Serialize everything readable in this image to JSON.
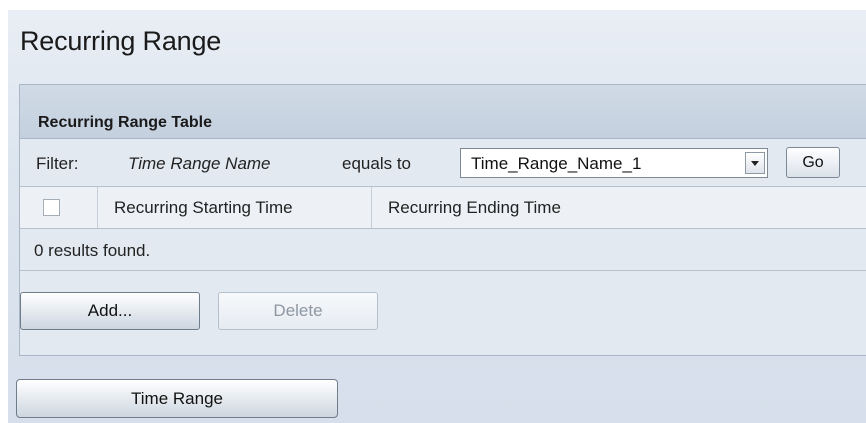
{
  "page": {
    "title": "Recurring Range"
  },
  "table": {
    "title": "Recurring Range Table",
    "filter": {
      "label": "Filter:",
      "field": "Time Range Name",
      "operator": "equals to",
      "selected_value": "Time_Range_Name_1",
      "go_label": "Go"
    },
    "columns": [
      "Recurring Starting Time",
      "Recurring Ending Time"
    ],
    "results_text": "0 results found.",
    "actions": {
      "add_label": "Add...",
      "delete_label": "Delete"
    }
  },
  "footer": {
    "time_range_label": "Time Range"
  },
  "icons": {
    "dropdown": "chevron-down-icon",
    "checkbox": "checkbox-icon"
  },
  "colors": {
    "background": "#dde5ef",
    "table_header": "#c9d4e1",
    "button_border": "#6f7c8a"
  }
}
